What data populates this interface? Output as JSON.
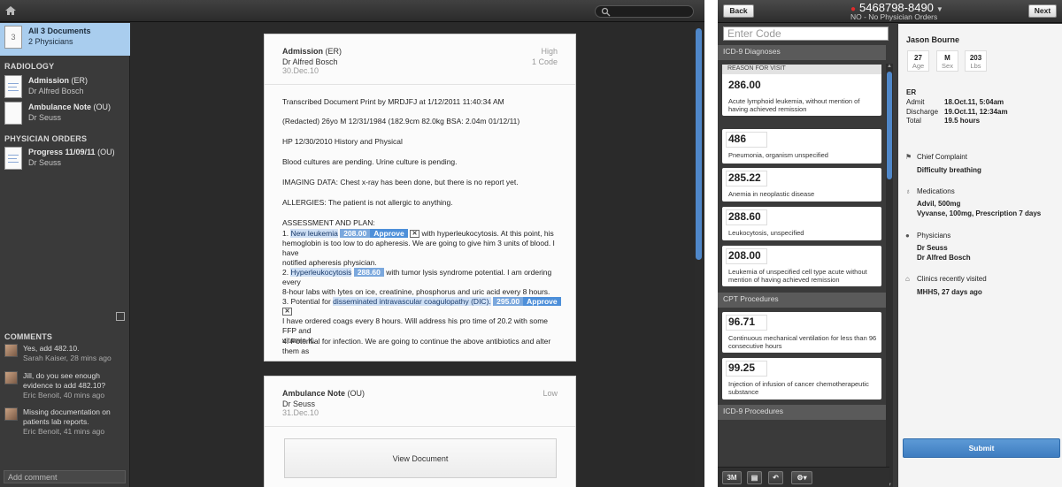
{
  "left_app": {
    "sidebar": {
      "all_docs": {
        "thumb": "3",
        "title": "All 3 Documents",
        "subtitle": "2 Physicians"
      },
      "sections": [
        {
          "title": "RADIOLOGY",
          "items": [
            {
              "name": "Admission",
              "type": "(ER)",
              "physician": "Dr Alfred Bosch"
            },
            {
              "name": "Ambulance Note",
              "type": "(OU)",
              "physician": "Dr Seuss"
            }
          ]
        },
        {
          "title": "PHYSICIAN ORDERS",
          "items": [
            {
              "name": "Progress 11/09/11",
              "type": "(OU)",
              "physician": "Dr Seuss"
            }
          ]
        }
      ],
      "comments_title": "COMMENTS",
      "comments": [
        {
          "text": "Yes, add 482.10.",
          "meta": "Sarah Kaiser, 28 mins ago"
        },
        {
          "text": "Jill, do you see enough evidence to add 482.10?",
          "meta": "Eric Benoit, 40 mins ago"
        },
        {
          "text": "Missing documentation on patients lab reports.",
          "meta": "Eric Benoit, 41 mins ago"
        }
      ],
      "add_comment_placeholder": "Add comment"
    },
    "doc1": {
      "title": "Admission",
      "type": "(ER)",
      "physician": "Dr Alfred Bosch",
      "date": "30.Dec.10",
      "priority": "High",
      "codes": "1 Code",
      "lines": {
        "l1": "Transcribed Document Print by MRDJFJ at 1/12/2011 11:40:34 AM",
        "l2": "(Redacted) 26yo M 12/31/1984 (182.9cm 82.0kg BSA: 2.04m 01/12/11)",
        "l3": "HP 12/30/2010 History and Physical",
        "l4": "Blood cultures are pending. Urine culture is pending.",
        "l5": "IMAGING DATA: Chest x-ray has been done, but there is no report yet.",
        "l6": "ALLERGIES: The patient is not allergic to anything.",
        "l7": "ASSESSMENT AND PLAN:",
        "p1_pre": "1. ",
        "p1_hl": "New leukemia",
        "p1_code": "208.00",
        "p1_approve": "Approve",
        "p1_x": "✕",
        "p1_a": "with hyperleukocytosis. At this point, his",
        "p1_b": "hemoglobin is too low to do apheresis. We are going to give him 3 units of blood. I have",
        "p1_c": "notified apheresis physician.",
        "p2_pre": "2. ",
        "p2_hl": "Hyperleukocytosis",
        "p2_code": "288.60",
        "p2_a": "with tumor lysis syndrome potential. I am ordering every",
        "p2_b": "8-hour labs with lytes on ice, creatinine, phosphorus and uric acid every 8 hours.",
        "p3_pre": "3. Potential for ",
        "p3_hl": "disseminated intravascular coagulopathy (DIC).",
        "p3_code": "295.00",
        "p3_approve": "Approve",
        "p3_x": "✕",
        "p3_a": "I have ordered coags every 8 hours. Will address his pro time of 20.2 with some FFP and",
        "p3_b": "vitamin K.",
        "p4": "4. Potential for infection. We are going to continue the above antibiotics and alter them as"
      }
    },
    "doc2": {
      "title": "Ambulance Note",
      "type": "(OU)",
      "physician": "Dr Seuss",
      "date": "31.Dec.10",
      "priority": "Low",
      "view_label": "View Document"
    }
  },
  "right_app": {
    "back_label": "Back",
    "next_label": "Next",
    "phone": "5468798-8490",
    "subtitle": "NO - No Physician Orders",
    "code_placeholder": "Enter Code",
    "categories": {
      "icd9_diag": "ICD-9 Diagnoses",
      "cpt": "CPT Procedures",
      "icd9_proc": "ICD-9 Procedures"
    },
    "reason_tag": "REASON FOR VISIT",
    "diagnoses": [
      {
        "code": "286.00",
        "desc": "Acute lymphoid leukemia, without mention of having achieved remission"
      },
      {
        "code": "486",
        "desc": "Pneumonia, organism unspecified"
      },
      {
        "code": "285.22",
        "desc": "Anemia in neoplastic disease"
      },
      {
        "code": "288.60",
        "desc": "Leukocytosis, unspecified"
      },
      {
        "code": "208.00",
        "desc": "Leukemia of unspecified cell type acute without mention of having achieved remission"
      }
    ],
    "procedures": [
      {
        "code": "96.71",
        "desc": "Continuous mechanical ventilation for less than 96 consecutive hours"
      },
      {
        "code": "99.25",
        "desc": "Injection of infusion of cancer chemotherapeutic substance"
      }
    ],
    "bottom_buttons": {
      "b1": "3M"
    },
    "patient": {
      "name": "Jason Bourne",
      "age": "27",
      "age_label": "Age",
      "sex": "M",
      "sex_label": "Sex",
      "weight": "203",
      "weight_label": "Lbs",
      "unit": "ER",
      "admit_label": "Admit",
      "admit": "18.Oct.11, 5:04am",
      "discharge_label": "Discharge",
      "discharge": "19.Oct.11, 12:34am",
      "total_label": "Total",
      "total": "19.5 hours",
      "complaint_label": "Chief Complaint",
      "complaint": "Difficulty breathing",
      "meds_label": "Medications",
      "med1": "Advil, 500mg",
      "med2": "Vyvanse, 100mg, Prescription 7 days",
      "phys_label": "Physicians",
      "phys1": "Dr Seuss",
      "phys2": "Dr Alfred Bosch",
      "clinics_label": "Clinics recently visited",
      "clinics": "MHHS, 27 days ago"
    },
    "submit_label": "Submit"
  }
}
